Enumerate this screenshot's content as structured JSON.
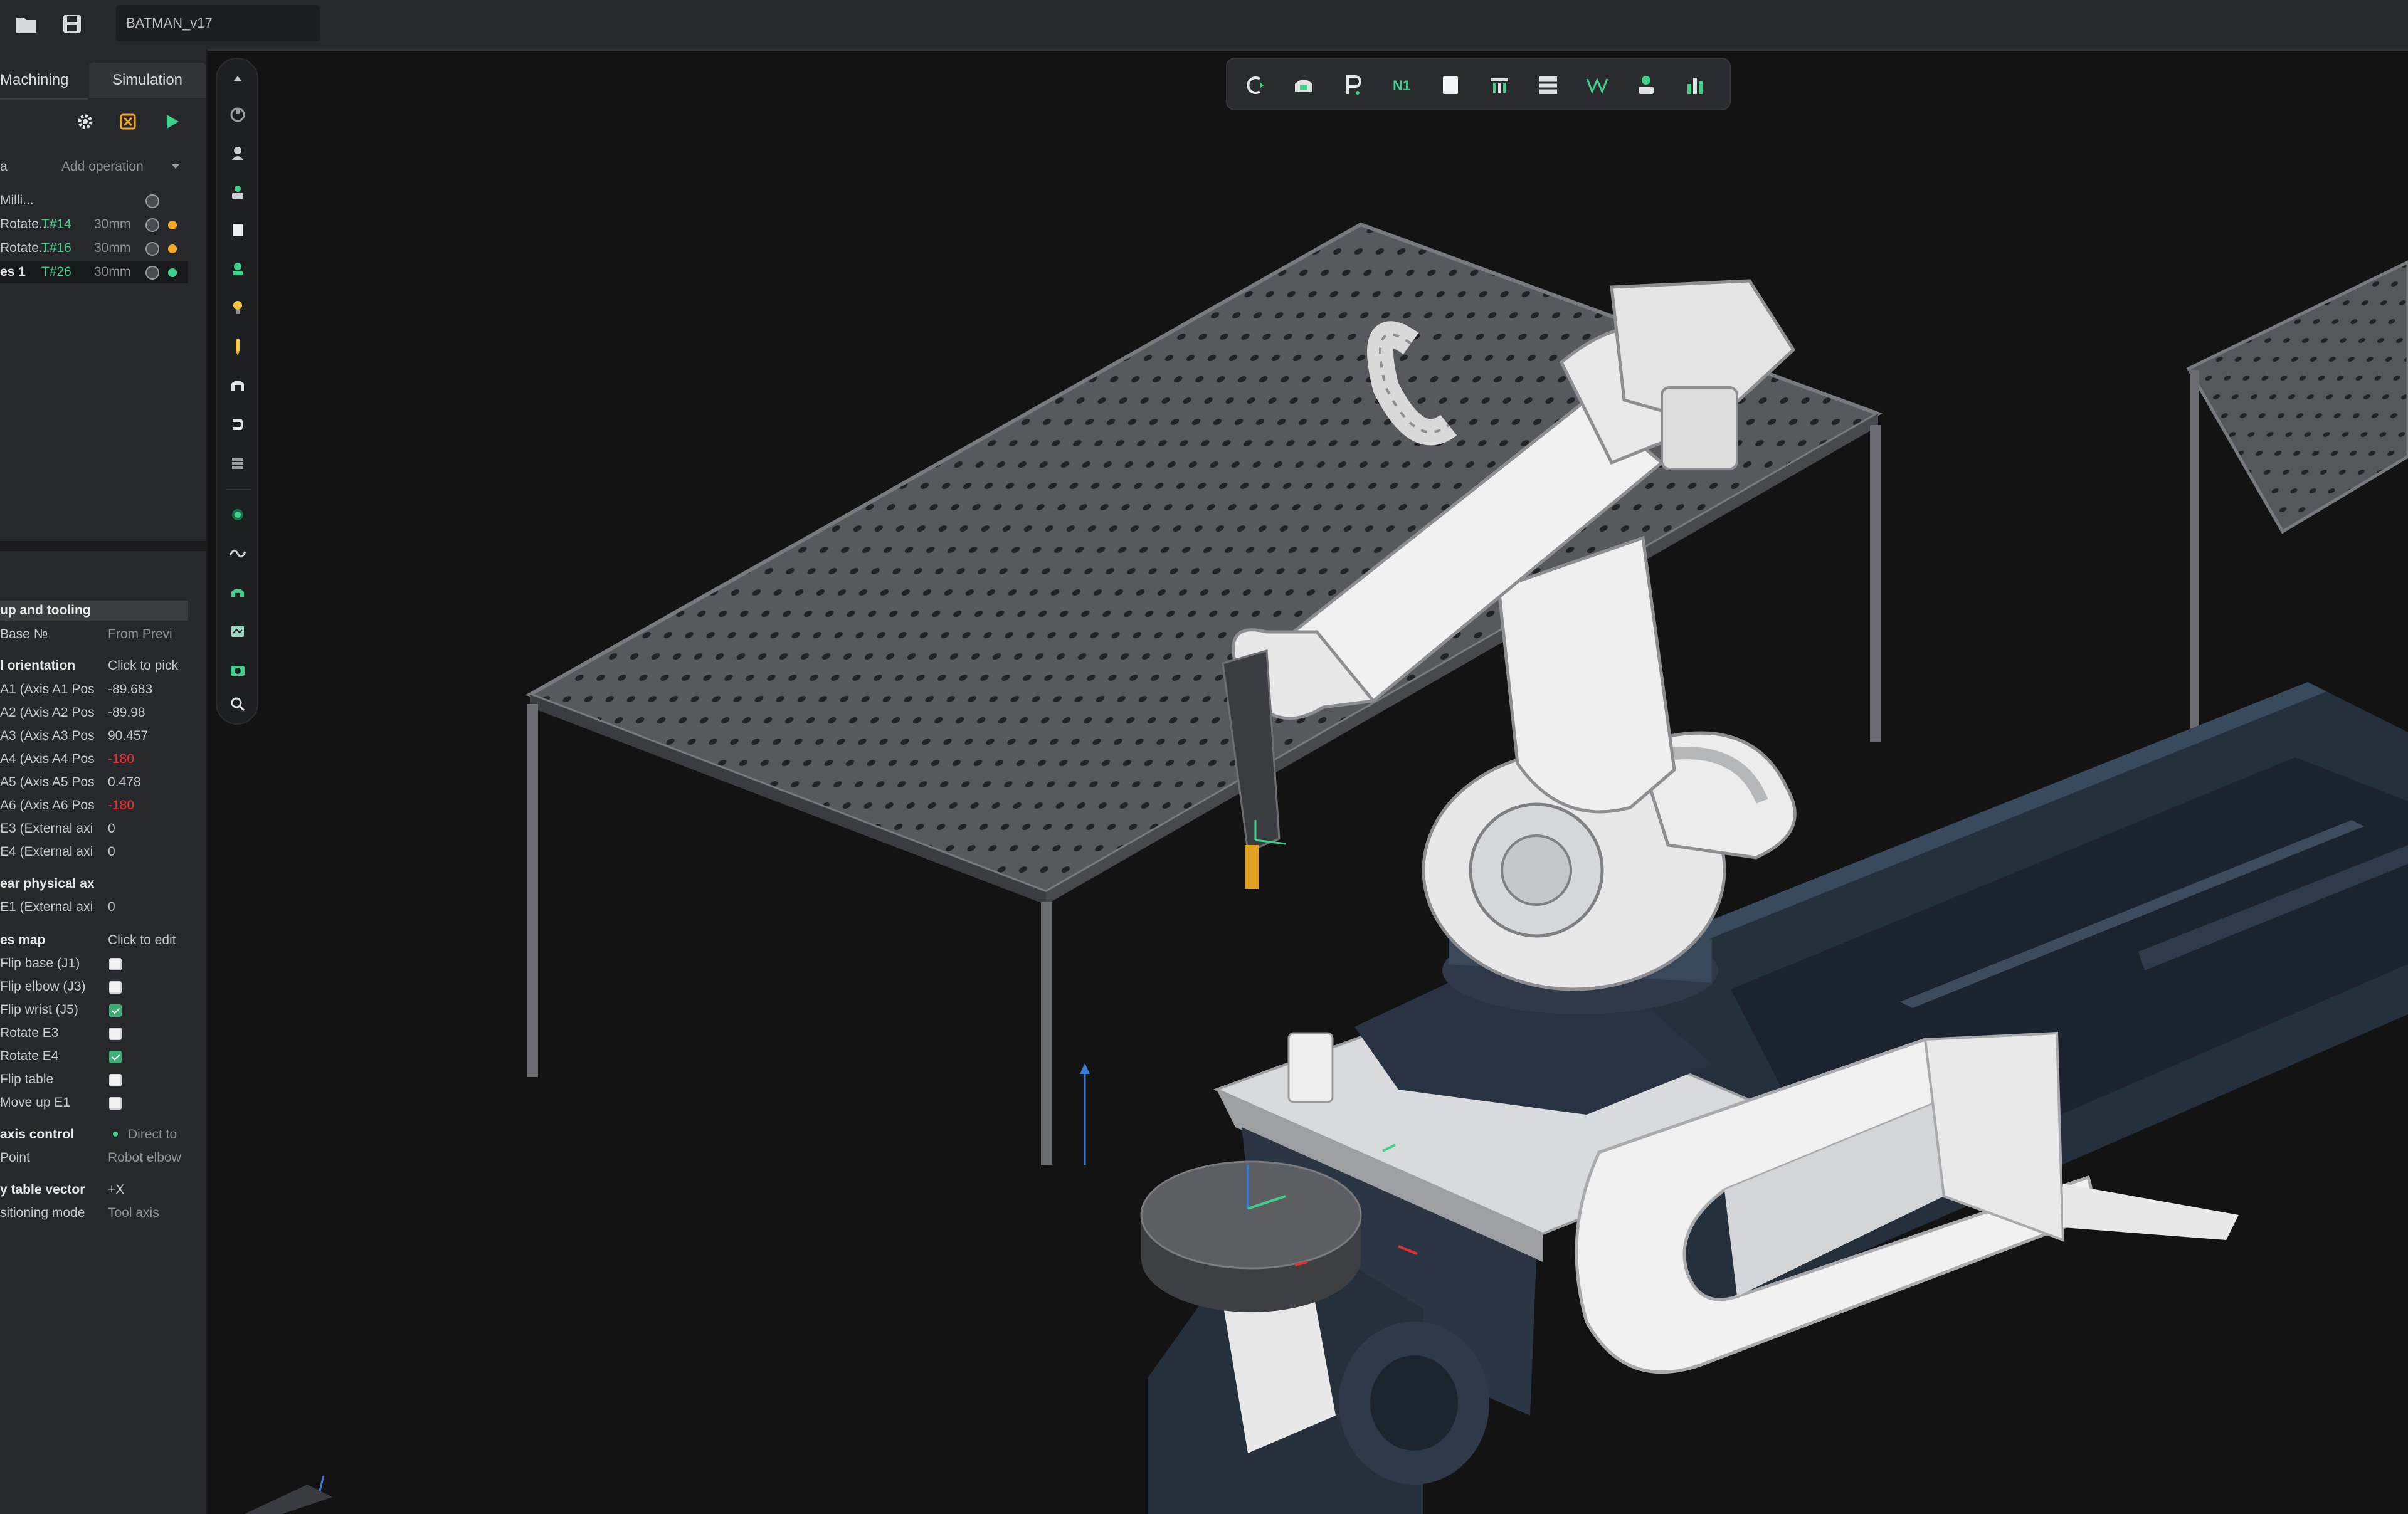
{
  "title_bar": {
    "file_name": "BATMAN_v17"
  },
  "left_panel": {
    "tabs": [
      "Machining",
      "Simulation"
    ],
    "add_operation": "Add operation",
    "operations": [
      {
        "name": "Milli...",
        "tool": "",
        "size": ""
      },
      {
        "name": "Rotate...",
        "tool": "T#14",
        "size": "30mm"
      },
      {
        "name": "Rotate...",
        "tool": "T#16",
        "size": "30mm"
      },
      {
        "name": "es 1",
        "tool": "T#26",
        "size": "30mm"
      }
    ],
    "setup_section": {
      "header": "up and tooling",
      "base_label": "Base №",
      "base_value": "From Previ",
      "orientation_label": "l orientation",
      "orientation_value": "Click to pick",
      "axes": [
        {
          "label": "A1 (Axis A1 Pos",
          "value": "-89.683",
          "color": "normal"
        },
        {
          "label": "A2 (Axis A2 Pos",
          "value": "-89.98",
          "color": "normal"
        },
        {
          "label": "A3 (Axis A3 Pos",
          "value": "90.457",
          "color": "normal"
        },
        {
          "label": "A4 (Axis A4 Pos",
          "value": "-180",
          "color": "red"
        },
        {
          "label": "A5 (Axis A5 Pos",
          "value": "0.478",
          "color": "normal"
        },
        {
          "label": "A6 (Axis A6 Pos",
          "value": "-180",
          "color": "red"
        },
        {
          "label": "E3 (External axi",
          "value": "0",
          "color": "normal"
        },
        {
          "label": "E4 (External axi",
          "value": "0",
          "color": "normal"
        }
      ],
      "linear_header": "ear physical ax",
      "linear_axis": {
        "label": "E1 (External axi",
        "value": "0"
      },
      "flags_header": "es map",
      "flags_value": "Click to edit",
      "flags": [
        {
          "label": "Flip base (J1)",
          "checked": false
        },
        {
          "label": "Flip elbow (J3)",
          "checked": false
        },
        {
          "label": "Flip wrist (J5)",
          "checked": true
        },
        {
          "label": "Rotate E3",
          "checked": false
        },
        {
          "label": "Rotate E4",
          "checked": true
        },
        {
          "label": "Flip table",
          "checked": false
        },
        {
          "label": "Move up E1",
          "checked": false
        }
      ],
      "axis_control_label": "axis control",
      "axis_control_value": "Direct to",
      "point_label": "Point",
      "point_value": "Robot elbow",
      "table_vector_label": "y table vector",
      "table_vector_value": "+X",
      "positioning_label": "sitioning mode",
      "positioning_value": "Tool axis"
    }
  },
  "colors": {
    "accent_green": "#3fd18a",
    "warning_orange": "#f5a623",
    "error_red": "#ff2a2a",
    "robot_white": "#e9e9e9",
    "frame_navy": "#2d3a4b"
  },
  "vertical_toolbar_icons": [
    "scroll-up-icon",
    "tool-icon",
    "user-icon",
    "stack-icon",
    "square-icon",
    "robot-icon",
    "bulb-icon",
    "spindle-icon",
    "tool-holder-icon",
    "magnet-icon",
    "grid-icon",
    "circle-icon",
    "wave-icon",
    "gear-head-icon",
    "library-icon",
    "camera-icon",
    "zoom-icon"
  ],
  "top_toolbar_icons": [
    "c-icon",
    "head-icon",
    "p-icon",
    "n1-icon",
    "square-icon",
    "tool-rack-icon",
    "table-icon",
    "vw-icon",
    "stack-icon",
    "bar-chart-icon"
  ],
  "top_toolbar_texts": {
    "n1": "N1",
    "c": "C",
    "p": "P",
    "vw": "VV"
  }
}
